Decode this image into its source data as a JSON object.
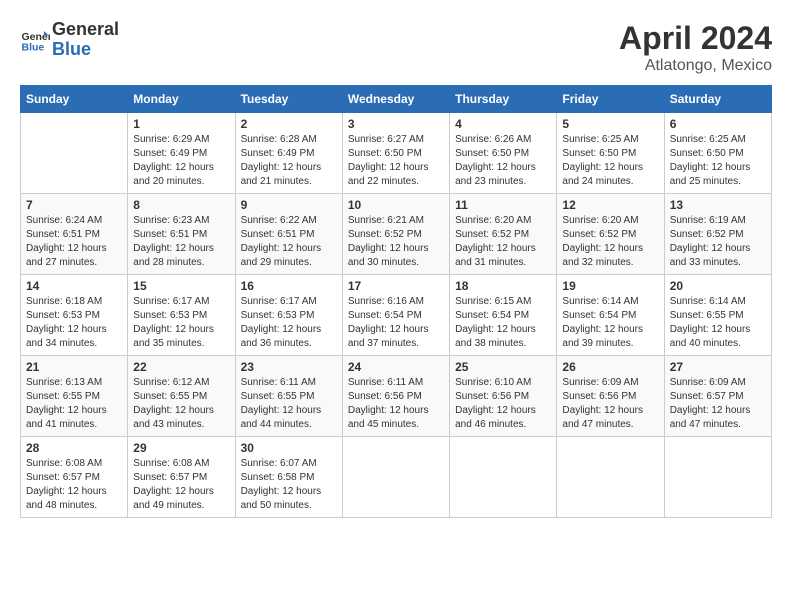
{
  "header": {
    "logo_general": "General",
    "logo_blue": "Blue",
    "title": "April 2024",
    "subtitle": "Atlatongo, Mexico"
  },
  "days_of_week": [
    "Sunday",
    "Monday",
    "Tuesday",
    "Wednesday",
    "Thursday",
    "Friday",
    "Saturday"
  ],
  "weeks": [
    [
      {
        "day": "",
        "sunrise": "",
        "sunset": "",
        "daylight": ""
      },
      {
        "day": "1",
        "sunrise": "Sunrise: 6:29 AM",
        "sunset": "Sunset: 6:49 PM",
        "daylight": "Daylight: 12 hours and 20 minutes."
      },
      {
        "day": "2",
        "sunrise": "Sunrise: 6:28 AM",
        "sunset": "Sunset: 6:49 PM",
        "daylight": "Daylight: 12 hours and 21 minutes."
      },
      {
        "day": "3",
        "sunrise": "Sunrise: 6:27 AM",
        "sunset": "Sunset: 6:50 PM",
        "daylight": "Daylight: 12 hours and 22 minutes."
      },
      {
        "day": "4",
        "sunrise": "Sunrise: 6:26 AM",
        "sunset": "Sunset: 6:50 PM",
        "daylight": "Daylight: 12 hours and 23 minutes."
      },
      {
        "day": "5",
        "sunrise": "Sunrise: 6:25 AM",
        "sunset": "Sunset: 6:50 PM",
        "daylight": "Daylight: 12 hours and 24 minutes."
      },
      {
        "day": "6",
        "sunrise": "Sunrise: 6:25 AM",
        "sunset": "Sunset: 6:50 PM",
        "daylight": "Daylight: 12 hours and 25 minutes."
      }
    ],
    [
      {
        "day": "7",
        "sunrise": "Sunrise: 6:24 AM",
        "sunset": "Sunset: 6:51 PM",
        "daylight": "Daylight: 12 hours and 27 minutes."
      },
      {
        "day": "8",
        "sunrise": "Sunrise: 6:23 AM",
        "sunset": "Sunset: 6:51 PM",
        "daylight": "Daylight: 12 hours and 28 minutes."
      },
      {
        "day": "9",
        "sunrise": "Sunrise: 6:22 AM",
        "sunset": "Sunset: 6:51 PM",
        "daylight": "Daylight: 12 hours and 29 minutes."
      },
      {
        "day": "10",
        "sunrise": "Sunrise: 6:21 AM",
        "sunset": "Sunset: 6:52 PM",
        "daylight": "Daylight: 12 hours and 30 minutes."
      },
      {
        "day": "11",
        "sunrise": "Sunrise: 6:20 AM",
        "sunset": "Sunset: 6:52 PM",
        "daylight": "Daylight: 12 hours and 31 minutes."
      },
      {
        "day": "12",
        "sunrise": "Sunrise: 6:20 AM",
        "sunset": "Sunset: 6:52 PM",
        "daylight": "Daylight: 12 hours and 32 minutes."
      },
      {
        "day": "13",
        "sunrise": "Sunrise: 6:19 AM",
        "sunset": "Sunset: 6:52 PM",
        "daylight": "Daylight: 12 hours and 33 minutes."
      }
    ],
    [
      {
        "day": "14",
        "sunrise": "Sunrise: 6:18 AM",
        "sunset": "Sunset: 6:53 PM",
        "daylight": "Daylight: 12 hours and 34 minutes."
      },
      {
        "day": "15",
        "sunrise": "Sunrise: 6:17 AM",
        "sunset": "Sunset: 6:53 PM",
        "daylight": "Daylight: 12 hours and 35 minutes."
      },
      {
        "day": "16",
        "sunrise": "Sunrise: 6:17 AM",
        "sunset": "Sunset: 6:53 PM",
        "daylight": "Daylight: 12 hours and 36 minutes."
      },
      {
        "day": "17",
        "sunrise": "Sunrise: 6:16 AM",
        "sunset": "Sunset: 6:54 PM",
        "daylight": "Daylight: 12 hours and 37 minutes."
      },
      {
        "day": "18",
        "sunrise": "Sunrise: 6:15 AM",
        "sunset": "Sunset: 6:54 PM",
        "daylight": "Daylight: 12 hours and 38 minutes."
      },
      {
        "day": "19",
        "sunrise": "Sunrise: 6:14 AM",
        "sunset": "Sunset: 6:54 PM",
        "daylight": "Daylight: 12 hours and 39 minutes."
      },
      {
        "day": "20",
        "sunrise": "Sunrise: 6:14 AM",
        "sunset": "Sunset: 6:55 PM",
        "daylight": "Daylight: 12 hours and 40 minutes."
      }
    ],
    [
      {
        "day": "21",
        "sunrise": "Sunrise: 6:13 AM",
        "sunset": "Sunset: 6:55 PM",
        "daylight": "Daylight: 12 hours and 41 minutes."
      },
      {
        "day": "22",
        "sunrise": "Sunrise: 6:12 AM",
        "sunset": "Sunset: 6:55 PM",
        "daylight": "Daylight: 12 hours and 43 minutes."
      },
      {
        "day": "23",
        "sunrise": "Sunrise: 6:11 AM",
        "sunset": "Sunset: 6:55 PM",
        "daylight": "Daylight: 12 hours and 44 minutes."
      },
      {
        "day": "24",
        "sunrise": "Sunrise: 6:11 AM",
        "sunset": "Sunset: 6:56 PM",
        "daylight": "Daylight: 12 hours and 45 minutes."
      },
      {
        "day": "25",
        "sunrise": "Sunrise: 6:10 AM",
        "sunset": "Sunset: 6:56 PM",
        "daylight": "Daylight: 12 hours and 46 minutes."
      },
      {
        "day": "26",
        "sunrise": "Sunrise: 6:09 AM",
        "sunset": "Sunset: 6:56 PM",
        "daylight": "Daylight: 12 hours and 47 minutes."
      },
      {
        "day": "27",
        "sunrise": "Sunrise: 6:09 AM",
        "sunset": "Sunset: 6:57 PM",
        "daylight": "Daylight: 12 hours and 47 minutes."
      }
    ],
    [
      {
        "day": "28",
        "sunrise": "Sunrise: 6:08 AM",
        "sunset": "Sunset: 6:57 PM",
        "daylight": "Daylight: 12 hours and 48 minutes."
      },
      {
        "day": "29",
        "sunrise": "Sunrise: 6:08 AM",
        "sunset": "Sunset: 6:57 PM",
        "daylight": "Daylight: 12 hours and 49 minutes."
      },
      {
        "day": "30",
        "sunrise": "Sunrise: 6:07 AM",
        "sunset": "Sunset: 6:58 PM",
        "daylight": "Daylight: 12 hours and 50 minutes."
      },
      {
        "day": "",
        "sunrise": "",
        "sunset": "",
        "daylight": ""
      },
      {
        "day": "",
        "sunrise": "",
        "sunset": "",
        "daylight": ""
      },
      {
        "day": "",
        "sunrise": "",
        "sunset": "",
        "daylight": ""
      },
      {
        "day": "",
        "sunrise": "",
        "sunset": "",
        "daylight": ""
      }
    ]
  ]
}
